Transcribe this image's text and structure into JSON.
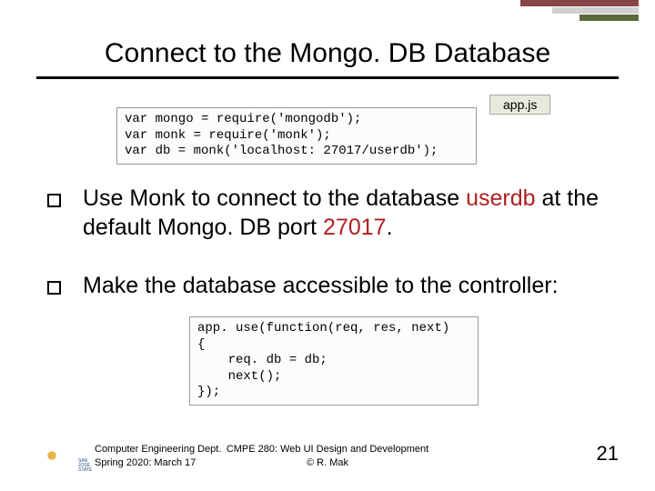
{
  "title": "Connect to the Mongo. DB Database",
  "code_label": "app.js",
  "code1": "var mongo = require('mongodb');\nvar monk = require('monk');\nvar db = monk('localhost: 27017/userdb');",
  "bullet1_a": "Use Monk to connect to the database ",
  "bullet1_b": "userdb",
  "bullet1_c": " at the default Mongo. DB port ",
  "bullet1_d": "27017",
  "bullet1_e": ".",
  "bullet2": "Make the database accessible to the controller:",
  "code2": "app. use(function(req, res, next)\n{\n    req. db = db;\n    next();\n});",
  "footer_left_l1": "Computer Engineering Dept.",
  "footer_left_l2": "Spring 2020: March 17",
  "footer_mid_l1": "CMPE 280: Web UI Design and Development",
  "footer_mid_l2": "© R. Mak",
  "page_num": "21",
  "logo_text": "SAN JOSÉ STATE"
}
